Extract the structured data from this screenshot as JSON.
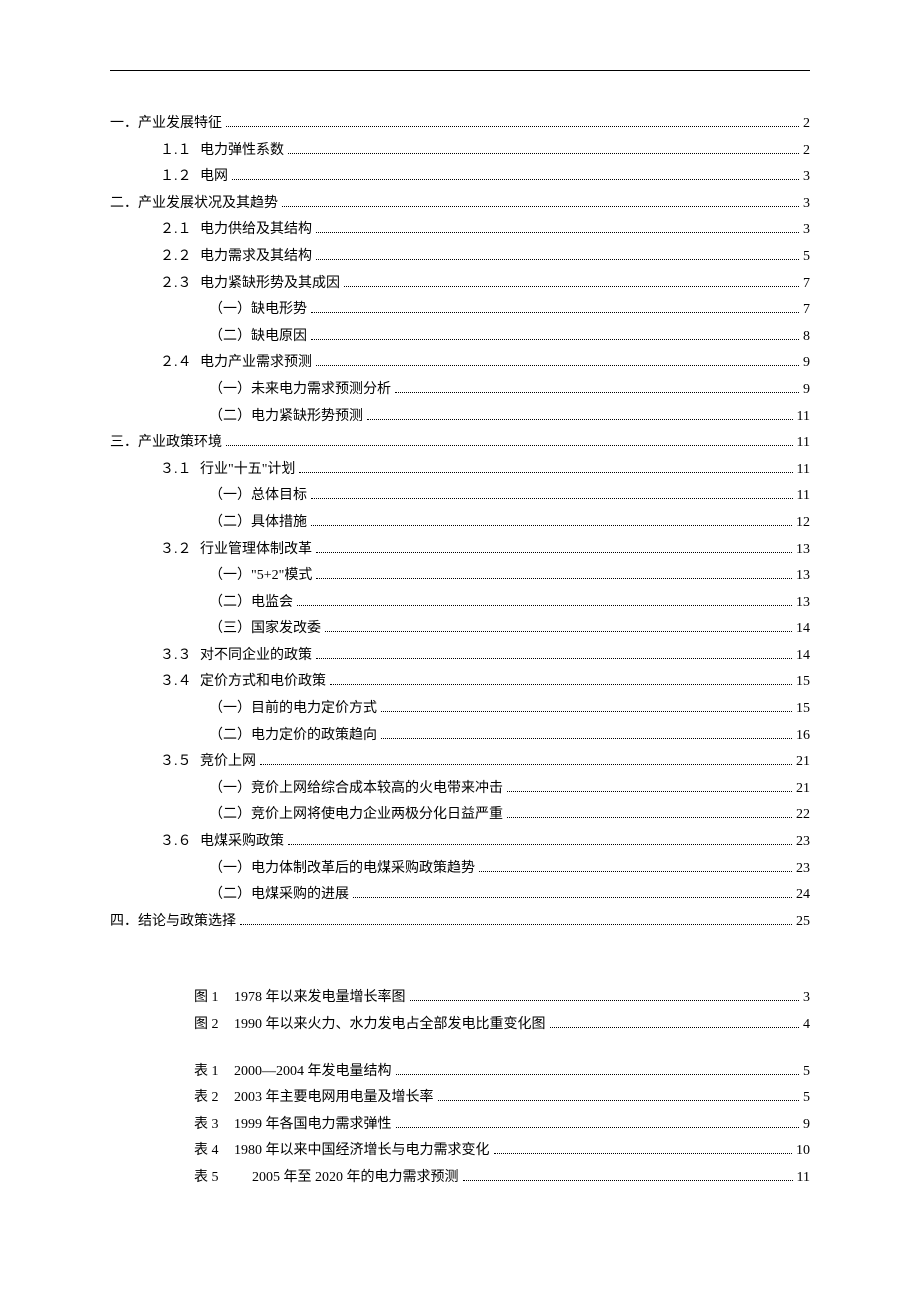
{
  "toc": [
    {
      "lvl": 1,
      "num": "一．",
      "title": "产业发展特征",
      "page": "2"
    },
    {
      "lvl": 2,
      "num": "１.１",
      "title": "电力弹性系数",
      "page": "2"
    },
    {
      "lvl": 2,
      "num": "１.２",
      "title": "电网",
      "page": "3"
    },
    {
      "lvl": 1,
      "num": "二．",
      "title": "产业发展状况及其趋势",
      "page": "3"
    },
    {
      "lvl": 2,
      "num": "２.１",
      "title": "电力供给及其结构",
      "page": "3"
    },
    {
      "lvl": 2,
      "num": "２.２",
      "title": "电力需求及其结构",
      "page": "5"
    },
    {
      "lvl": 2,
      "num": "２.３",
      "title": "电力紧缺形势及其成因",
      "page": "7"
    },
    {
      "lvl": 3,
      "num": "",
      "title": "（一）缺电形势",
      "page": "7"
    },
    {
      "lvl": 3,
      "num": "",
      "title": "（二）缺电原因",
      "page": "8"
    },
    {
      "lvl": 2,
      "num": "２.４",
      "title": "电力产业需求预测",
      "page": "9"
    },
    {
      "lvl": 3,
      "num": "",
      "title": "（一）未来电力需求预测分析",
      "page": "9"
    },
    {
      "lvl": 3,
      "num": "",
      "title": "（二）电力紧缺形势预测",
      "page": "11"
    },
    {
      "lvl": 1,
      "num": "三．",
      "title": "产业政策环境",
      "page": "11"
    },
    {
      "lvl": 2,
      "num": "３.１",
      "title": "行业\"十五\"计划",
      "page": "11"
    },
    {
      "lvl": 3,
      "num": "",
      "title": "（一）总体目标",
      "page": "11"
    },
    {
      "lvl": 3,
      "num": "",
      "title": "（二）具体措施",
      "page": "12"
    },
    {
      "lvl": 2,
      "num": "３.２",
      "title": "行业管理体制改革",
      "page": "13"
    },
    {
      "lvl": 3,
      "num": "",
      "title": "（一）\"5+2\"模式 ",
      "page": "13"
    },
    {
      "lvl": 3,
      "num": "",
      "title": "（二）电监会",
      "page": "13"
    },
    {
      "lvl": 3,
      "num": "",
      "title": "（三）国家发改委",
      "page": "14"
    },
    {
      "lvl": 2,
      "num": "３.３",
      "title": "对不同企业的政策",
      "page": "14"
    },
    {
      "lvl": 2,
      "num": "３.４",
      "title": "定价方式和电价政策",
      "page": "15"
    },
    {
      "lvl": 3,
      "num": "",
      "title": "（一）目前的电力定价方式",
      "page": "15"
    },
    {
      "lvl": 3,
      "num": "",
      "title": "（二）电力定价的政策趋向",
      "page": "16"
    },
    {
      "lvl": 2,
      "num": "３.５",
      "title": "竞价上网",
      "page": "21"
    },
    {
      "lvl": 3,
      "num": "",
      "title": "（一）竞价上网给综合成本较高的火电带来冲击",
      "page": "21"
    },
    {
      "lvl": 3,
      "num": "",
      "title": "（二）竞价上网将使电力企业两极分化日益严重",
      "page": "22"
    },
    {
      "lvl": 2,
      "num": "３.６",
      "title": "电煤采购政策",
      "page": "23"
    },
    {
      "lvl": 3,
      "num": "",
      "title": "（一）电力体制改革后的电煤采购政策趋势",
      "page": "23"
    },
    {
      "lvl": 3,
      "num": "",
      "title": "（二）电煤采购的进展",
      "page": "24"
    },
    {
      "lvl": 1,
      "num": "四．",
      "title": "结论与政策选择",
      "page": "25"
    }
  ],
  "figures": [
    {
      "num": "图 1",
      "title": "1978 年以来发电量增长率图",
      "page": "3"
    },
    {
      "num": "图 2",
      "title": "1990 年以来火力、水力发电占全部发电比重变化图",
      "page": "4"
    }
  ],
  "tables": [
    {
      "num": "表 1",
      "title": "2000—2004 年发电量结构",
      "page": "5"
    },
    {
      "num": "表 2",
      "title": "2003 年主要电网用电量及增长率",
      "page": "5"
    },
    {
      "num": "表 3",
      "title": "1999 年各国电力需求弹性",
      "page": "9"
    },
    {
      "num": "表 4",
      "title": "1980 年以来中国经济增长与电力需求变化",
      "page": "10"
    },
    {
      "num": "表 5",
      "title": " 2005 年至 2020 年的电力需求预测",
      "page": "11",
      "wide": true
    }
  ]
}
